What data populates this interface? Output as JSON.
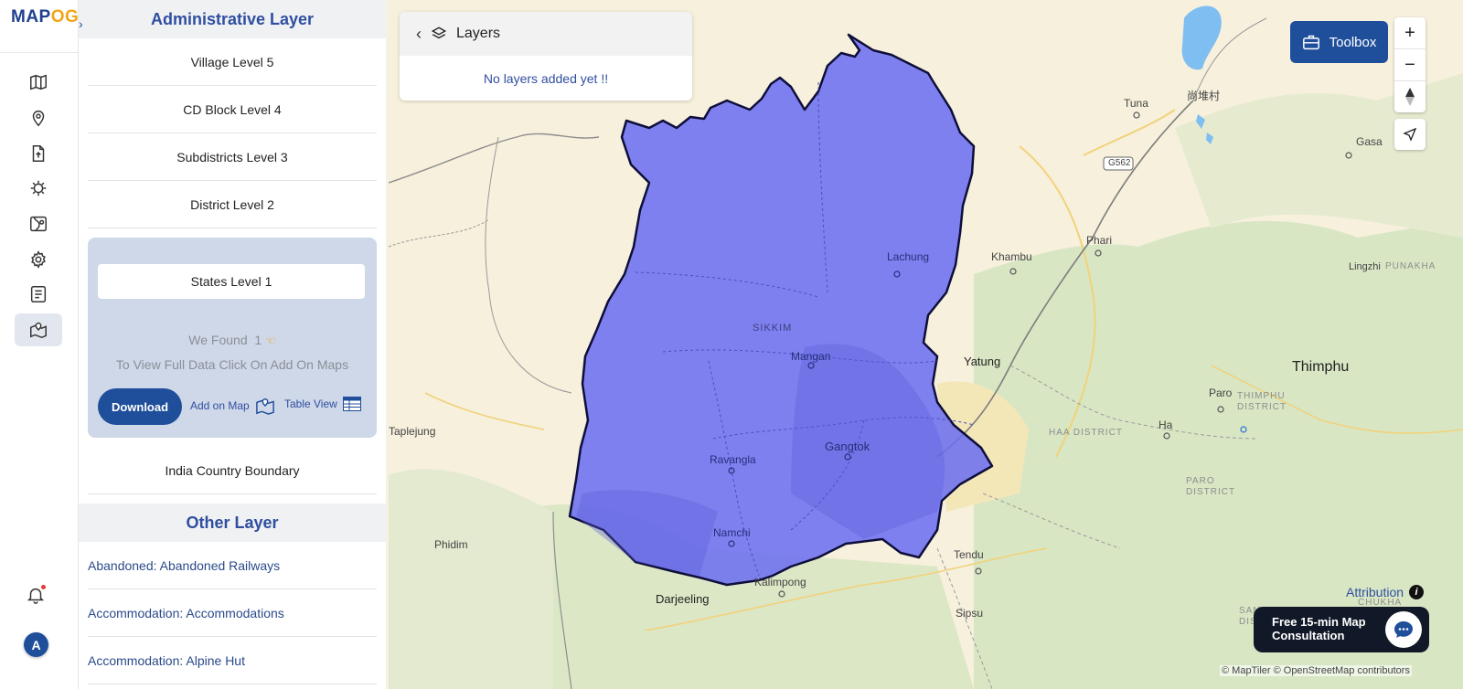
{
  "app": {
    "logo_main": "MAP",
    "logo_accent": "OG",
    "avatar_initial": "A"
  },
  "rail": {
    "icons": [
      "map-icon",
      "location-pin-icon",
      "upload-icon",
      "process-icon",
      "map-data-icon",
      "settings-icon",
      "report-icon",
      "administrative-map-icon"
    ],
    "active_index": 7
  },
  "panel": {
    "admin_title": "Administrative Layer",
    "levels": [
      "Village Level 5",
      "CD Block Level 4",
      "Subdistricts Level 3",
      "District Level 2"
    ],
    "selected_level": "States Level 1",
    "found_text": "We Found",
    "found_count": "1",
    "tip": "To View Full Data Click On Add On Maps",
    "download_label": "Download",
    "add_on_map_label": "Add on Map",
    "table_view_label": "Table View",
    "country_item": "India Country Boundary",
    "other_title": "Other Layer",
    "other_items": [
      "Abandoned: Abandoned Railways",
      "Accommodation: Accommodations",
      "Accommodation: Alpine Hut"
    ]
  },
  "layers_panel": {
    "title": "Layers",
    "empty_message": "No layers added yet !!"
  },
  "toolbox": {
    "label": "Toolbox"
  },
  "map": {
    "highlight_color": "#6b6df2",
    "labels": {
      "lachung": "Lachung",
      "sikkim": "SIKKIM",
      "mangan": "Mangan",
      "gangtok": "Gangtok",
      "ravangla": "Ravangla",
      "namchi": "Namchi",
      "kalimpong": "Kalimpong",
      "darjeeling": "Darjeeling",
      "taplejung": "Taplejung",
      "phidim": "Phidim",
      "yatung": "Yatung",
      "khambu": "Khambu",
      "phari": "Phari",
      "tuna": "Tuna",
      "chinese_village": "尚堆村",
      "g562": "G562",
      "thimphu": "Thimphu",
      "paro": "Paro",
      "ha": "Ha",
      "gasa": "Gasa",
      "tendu": "Tendu",
      "sipsu": "Sipsu",
      "lingzhi": "Lingzhi",
      "thimphu_district": "THIMPHU DISTRICT",
      "haa_district": "HAA DISTRICT",
      "paro_district": "PARO DISTRICT",
      "samtse_district": "SAMTSE DISTRICT",
      "punakha": "PUNAKHA",
      "chukha": "CHUKHA"
    },
    "attribution_label": "Attribution",
    "copyright": "© MapTiler © OpenStreetMap contributors"
  },
  "consult": {
    "label": "Free 15-min Map Consultation"
  }
}
